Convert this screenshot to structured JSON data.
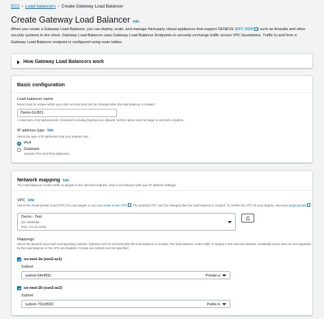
{
  "breadcrumb": {
    "items": [
      "EC2",
      "Load balancers"
    ],
    "current": "Create Gateway Load Balancer"
  },
  "page": {
    "title": "Create Gateway Load Balancer",
    "info": "Info",
    "desc_1": "When you create a Gateway Load Balancer, you can deploy, scale, and manage third-party virtual appliances that support GENEVE (",
    "desc_link": "RFC 8926",
    "desc_2": ") such as firewalls and other security systems in the cloud. Gateway Load Balancer uses Gateway Load Balancer Endpoints to securely exchange traffic across VPC boundaries. Traffic to and from a Gateway Load Balancer endpoint is configured using route tables."
  },
  "how_panel": {
    "title": "How Gateway Load Balancers work"
  },
  "basic": {
    "title": "Basic configuration",
    "name_label": "Load balancer name",
    "name_hint": "Name must be unique within your AWS account and can't be changed after the load balancer is created.",
    "name_value": "Demo-GLB01",
    "name_constraint": "A maximum of 32 alphanumeric characters including hyphens are allowed, but the name must not begin or end with a hyphen.",
    "ip_label": "IP address type",
    "ip_info": "Info",
    "ip_hint": "Select the type of IP addresses that your subnets use.",
    "ipv4": "IPv4",
    "dualstack": "Dualstack",
    "dualstack_sub": "Includes IPv4 and IPv6 addresses."
  },
  "network": {
    "title": "Network mapping",
    "info": "Info",
    "desc": "The load balancer routes traffic to targets in the selected subnets, and in accordance with your IP address settings.",
    "vpc_label": "VPC",
    "vpc_info": "Info",
    "vpc_hint_1": "Select the virtual private cloud (VPC) for your targets or you can ",
    "vpc_hint_link1": "create a new VPC",
    "vpc_hint_2": ". The selected VPC can't be changed after the load balancer is created. To confirm the VPC for your targets, view your ",
    "vpc_hint_link2": "target groups",
    "vpc_name": "Demo - Test",
    "vpc_id": "vpc-cda3e5a5",
    "vpc_cidr": "IPv4: 172.16.0.0/16",
    "mappings_label": "Mappings",
    "mappings_hint": "Select the desired zones and corresponding subnets. Subnets can't be removed after the load balancer is created. The load balancer routes traffic to targets in the selected subnets. Availability Zones that are not supported by the load balancer or the VPC are disabled. At least one subnet must be specified.",
    "zones": [
      {
        "name": "us-east-2a (use2-az1)",
        "subnet_label": "Subnet",
        "subnet_id": "subnet-54ef9f3c",
        "subnet_tag": "Private-a"
      },
      {
        "name": "us-east-2b (use2-az2)",
        "subnet_label": "Subnet",
        "subnet_id": "subnet-752c8509",
        "subnet_tag": "Public-b"
      }
    ]
  },
  "colors": {
    "link": "#0073bb",
    "background": "#f2f3f3",
    "border": "#aab7b8"
  },
  "icons": [
    "external-link-icon",
    "refresh-icon",
    "caret-down-icon",
    "check-icon",
    "expand-triangle-icon"
  ]
}
